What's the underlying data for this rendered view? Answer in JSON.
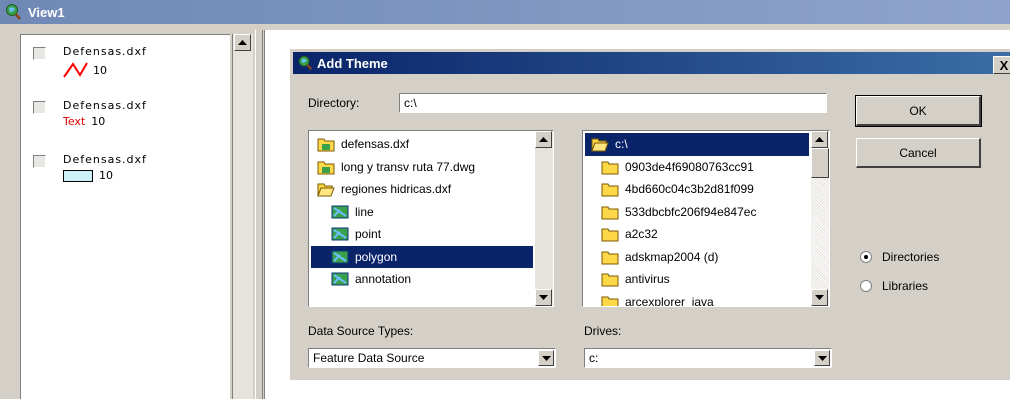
{
  "window": {
    "title": "View1",
    "icon": "globe-magnifier-icon"
  },
  "legend": {
    "items": [
      {
        "name": "Defensas.dxf",
        "symbol": "line-symbol",
        "symbol_color": "#ff0000",
        "size": "10"
      },
      {
        "name": "Defensas.dxf",
        "symbol": "text-symbol",
        "sample": "Text",
        "size": "10"
      },
      {
        "name": "Defensas.dxf",
        "symbol": "polygon-symbol",
        "fill_color": "#ccf2f8",
        "size": "10"
      }
    ]
  },
  "dialog": {
    "title": "Add Theme",
    "close_label": "X",
    "directory_label": "Directory:",
    "directory_value": "c:\\",
    "ok_label": "OK",
    "cancel_label": "Cancel",
    "files": [
      {
        "label": "defensas.dxf",
        "icon": "folder-icon"
      },
      {
        "label": "long y transv ruta 77.dwg",
        "icon": "folder-icon"
      },
      {
        "label": "regiones hidricas.dxf",
        "icon": "open-folder-icon"
      },
      {
        "label": "line",
        "icon": "theme-icon"
      },
      {
        "label": "point",
        "icon": "theme-icon"
      },
      {
        "label": "polygon",
        "icon": "theme-icon",
        "selected": true
      },
      {
        "label": "annotation",
        "icon": "theme-icon"
      }
    ],
    "dirs": [
      {
        "label": "c:\\",
        "icon": "open-folder-icon",
        "selected": true
      },
      {
        "label": "0903de4f69080763cc91",
        "icon": "folder-icon"
      },
      {
        "label": "4bd660c04c3b2d81f099",
        "icon": "folder-icon"
      },
      {
        "label": "533dbcbfc206f94e847ec",
        "icon": "folder-icon"
      },
      {
        "label": "a2c32",
        "icon": "folder-icon"
      },
      {
        "label": "adskmap2004 (d)",
        "icon": "folder-icon"
      },
      {
        "label": "antivirus",
        "icon": "folder-icon"
      },
      {
        "label": "arcexplorer_java",
        "icon": "folder-icon"
      }
    ],
    "data_source_label": "Data Source Types:",
    "data_source_value": "Feature Data Source",
    "drives_label": "Drives:",
    "drives_value": "c:",
    "radio_directories": "Directories",
    "radio_libraries": "Libraries",
    "radio_selected": "Directories"
  },
  "colors": {
    "title_active": "#0a246a",
    "title_inactive": "#7a92be",
    "selection": "#0a246a",
    "folder": "#ffd84a"
  }
}
